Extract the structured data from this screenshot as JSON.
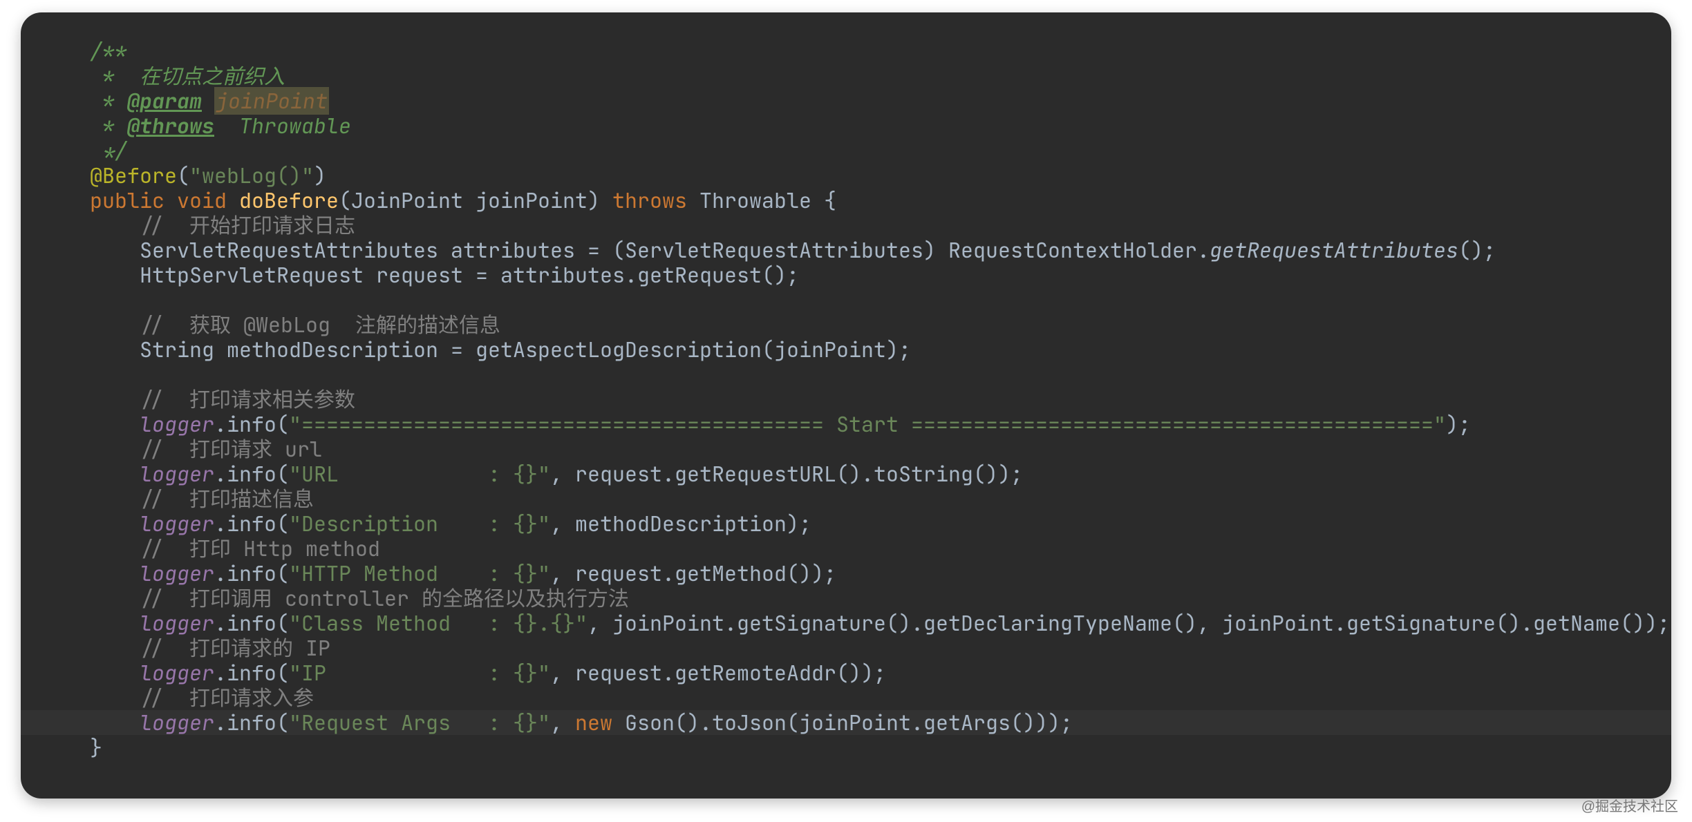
{
  "doc": {
    "open": "/**",
    "line1": " *  在切点之前织入",
    "param_tag": "@param",
    "param_name": "joinPoint",
    "throws_tag": "@throws",
    "throws_val": "Throwable",
    "close": " */"
  },
  "anno": {
    "before": "@Before",
    "value": "\"webLog()\""
  },
  "sig": {
    "public": "public",
    "void": "void",
    "name": "doBefore",
    "params": "(JoinPoint joinPoint)",
    "throws_kw": "throws",
    "throws_type": "Throwable {"
  },
  "body": {
    "c1": "//  开始打印请求日志",
    "l1a": "ServletRequestAttributes attributes = (ServletRequestAttributes) RequestContextHolder.",
    "l1b": "getRequestAttributes",
    "l1c": "();",
    "l2": "HttpServletRequest request = attributes.getRequest();",
    "c2": "//  获取 @WebLog  注解的描述信息",
    "l3": "String methodDescription = getAspectLogDescription(joinPoint);",
    "c3": "//  打印请求相关参数",
    "log": "logger",
    "info": ".info(",
    "close": ");",
    "s_start": "\"========================================== Start ==========================================\"",
    "c4": "//  打印请求 url",
    "s_url": "\"URL            : {}\"",
    "a_url": ", request.getRequestURL().toString());",
    "c5": "//  打印描述信息",
    "s_desc": "\"Description    : {}\"",
    "a_desc": ", methodDescription);",
    "c6": "//  打印 Http method",
    "s_http": "\"HTTP Method    : {}\"",
    "a_http": ", request.getMethod());",
    "c7": "//  打印调用 controller 的全路径以及执行方法",
    "s_class": "\"Class Method   : {}.{}\"",
    "a_class": ", joinPoint.getSignature().getDeclaringTypeName(), joinPoint.getSignature().getName());",
    "c8": "//  打印请求的 IP",
    "s_ip": "\"IP             : {}\"",
    "a_ip": ", request.getRemoteAddr());",
    "c9": "//  打印请求入参",
    "s_args": "\"Request Args   : {}\"",
    "a_args_pre": ", ",
    "new_kw": "new",
    "a_args_post": " Gson().toJson(joinPoint.getArgs()));",
    "end": "}"
  },
  "watermark": "@掘金技术社区"
}
